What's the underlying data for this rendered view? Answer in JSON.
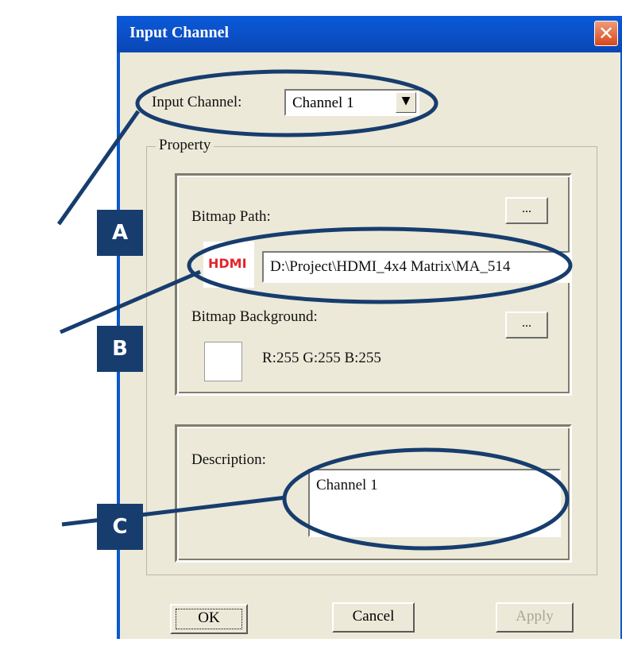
{
  "window": {
    "title": "Input Channel",
    "close_glyph": "✕"
  },
  "input_channel": {
    "label": "Input Channel:",
    "value": "Channel 1",
    "dropdown_glyph": "▼"
  },
  "property_group": {
    "label": "Property"
  },
  "bitmap_path": {
    "label": "Bitmap Path:",
    "browse_label": "...",
    "preview_text": "HDMI",
    "value": "D:\\Project\\HDMI_4x4 Matrix\\MA_514"
  },
  "bitmap_background": {
    "label": "Bitmap Background:",
    "browse_label": "...",
    "swatch_color": "#ffffff",
    "rgb_text": "R:255  G:255  B:255"
  },
  "description": {
    "label": "Description:",
    "value": "Channel 1"
  },
  "buttons": {
    "ok": "OK",
    "cancel": "Cancel",
    "apply": "Apply"
  },
  "callouts": {
    "a": "A",
    "b": "B",
    "c": "C"
  },
  "colors": {
    "callout": "#173d6e",
    "titlebar": "#0b4fc6",
    "hdmi_red": "#e2262b"
  }
}
